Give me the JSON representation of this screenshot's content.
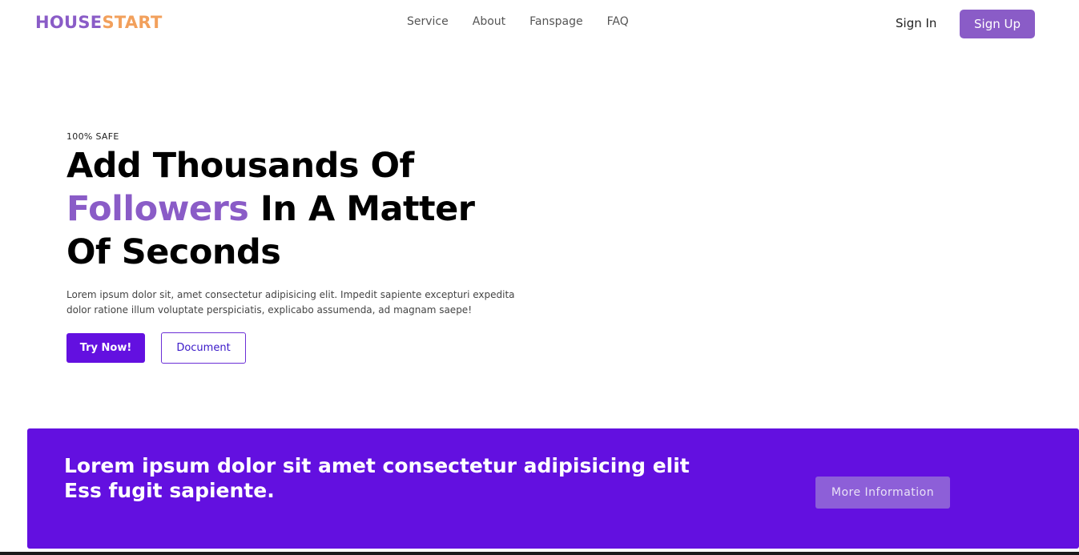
{
  "header": {
    "logo_part1": "HOUSE",
    "logo_part2": "START",
    "nav": [
      "Service",
      "About",
      "Fanspage",
      "FAQ"
    ],
    "sign_in": "Sign In",
    "sign_up": "Sign Up"
  },
  "hero": {
    "eyebrow": "100% SAFE",
    "headline_line1": "Add Thousands Of",
    "headline_accent": "Followers",
    "headline_line2_rest": " In A Matter",
    "headline_line3": "Of Seconds",
    "description": "Lorem ipsum dolor sit, amet consectetur adipisicing elit. Impedit sapiente excepturi expedita dolor ratione illum voluptate perspiciatis, explicabo assumenda, ad magnam saepe!",
    "try_button": "Try Now!",
    "document_button": "Document"
  },
  "banner": {
    "line1": "Lorem ipsum dolor sit amet consectetur adipisicing elit",
    "line2": "Ess fugit sapiente.",
    "button": "More Information"
  },
  "colors": {
    "brand_purple": "#8a5cc7",
    "brand_orange": "#f2a05c",
    "primary": "#6310e0"
  }
}
